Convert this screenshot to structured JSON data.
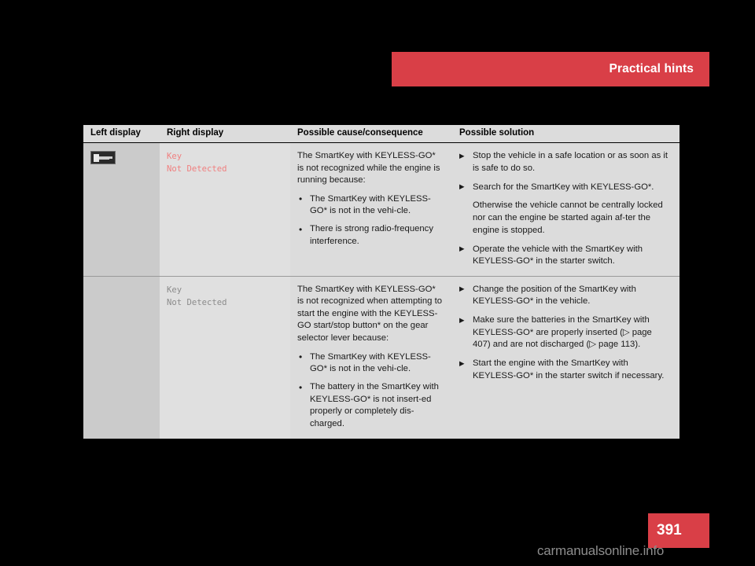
{
  "running_head": {
    "label": "Practical hints",
    "band_color": "#d93f47"
  },
  "folio": {
    "page_number": "391",
    "band_color": "#d93f47"
  },
  "watermark": {
    "text": "carmanualsonline.info",
    "color": "#8d8d8d"
  },
  "table": {
    "headers": {
      "left_display": "Left display",
      "right_display": "Right display",
      "cause": "Possible cause/consequence",
      "solution": "Possible solution"
    },
    "rows": [
      {
        "left_display_icon": "key-symbol-icon",
        "right_display": "Key\nNot Detected",
        "right_display_color": "#f08080",
        "cause": {
          "intro": "The SmartKey with KEYLESS-GO* is not recognized while the engine is running because:",
          "bullets": [
            "The SmartKey with KEYLESS-GO* is not in the vehi-cle.",
            "There is strong radio-frequency interference."
          ]
        },
        "solution": {
          "items": [
            {
              "marker": "arrow",
              "text": "Stop the vehicle in a safe location or as soon as it is safe to do so."
            },
            {
              "marker": "arrow",
              "text": "Search for the SmartKey with KEYLESS-GO*."
            },
            {
              "marker": "none",
              "text": "Otherwise the vehicle cannot be centrally locked nor can the engine be started again af-ter the engine is stopped."
            },
            {
              "marker": "arrow",
              "text": "Operate the vehicle with the SmartKey with KEYLESS-GO* in the starter switch."
            }
          ]
        }
      },
      {
        "left_display_icon": "",
        "right_display": "Key\nNot Detected",
        "right_display_color": "#8b8b8b",
        "cause": {
          "intro": "The SmartKey with KEYLESS-GO* is not recognized when attempting to start the engine with the KEYLESS-GO start/stop button* on the gear selector lever because:",
          "bullets": [
            "The SmartKey with KEYLESS-GO* is not in the vehi-cle.",
            "The battery in the SmartKey with KEYLESS-GO* is not insert-ed properly or completely dis-charged."
          ]
        },
        "solution": {
          "items": [
            {
              "marker": "arrow",
              "text": "Change the position of the SmartKey with KEYLESS-GO* in the vehicle."
            },
            {
              "marker": "arrow",
              "text": "Make sure the batteries in the SmartKey with KEYLESS-GO* are properly inserted (▷ page 407) and are not discharged (▷ page 113)."
            },
            {
              "marker": "arrow",
              "text": "Start the engine with the SmartKey with KEYLESS-GO* in the starter switch if necessary."
            }
          ]
        }
      }
    ]
  }
}
